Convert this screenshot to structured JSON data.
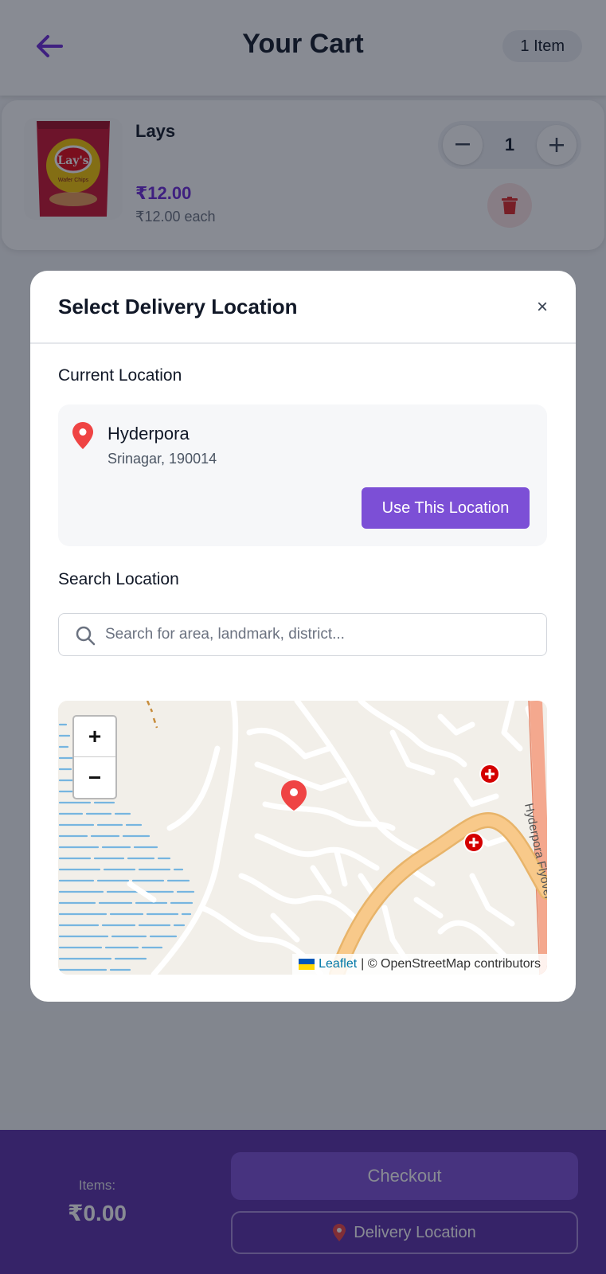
{
  "header": {
    "title": "Your Cart",
    "item_count": "1 Item"
  },
  "cart": {
    "items": [
      {
        "name": "Lays",
        "price": "₹12.00",
        "unit_price": "₹12.00 each",
        "quantity": "1",
        "package_text": "Lay's",
        "package_subtext": "Wafer Chips"
      }
    ]
  },
  "footer": {
    "items_label": "Items:",
    "items_total": "₹0.00",
    "checkout_label": "Checkout",
    "delivery_label": "Delivery Location"
  },
  "modal": {
    "title": "Select Delivery Location",
    "close_glyph": "×",
    "current_label": "Current Location",
    "current_location": {
      "name": "Hyderpora",
      "detail": "Srinagar, 190014"
    },
    "use_button": "Use This Location",
    "search_label": "Search Location",
    "search_placeholder": "Search for area, landmark, district...",
    "map": {
      "zoom_in": "+",
      "zoom_out": "−",
      "road_label": "Hyderpora Flyover",
      "attribution_link": "Leaflet",
      "attribution_text": "| © OpenStreetMap contributors"
    }
  },
  "colors": {
    "accent": "#7c4fd6",
    "price": "#6d28d9",
    "footer": "#5b2ea8",
    "pin": "#ef4444"
  }
}
